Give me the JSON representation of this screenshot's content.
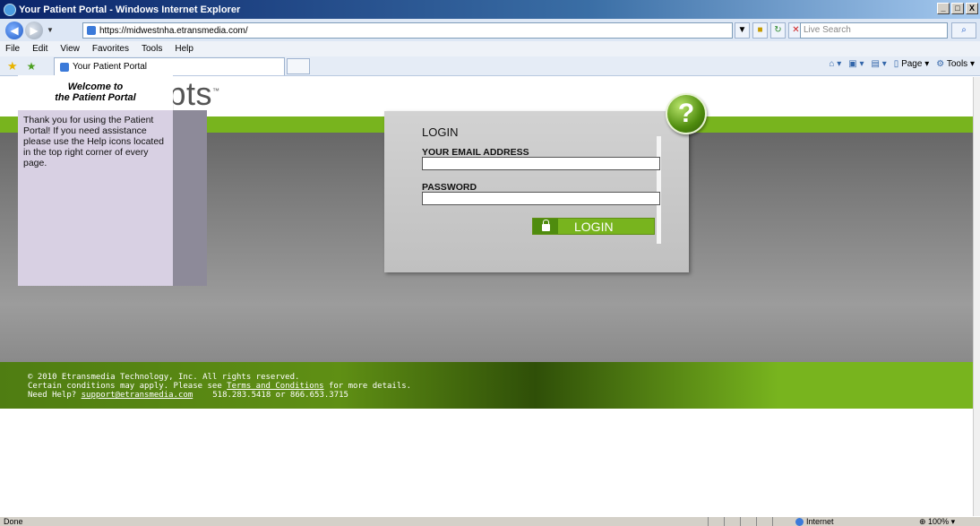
{
  "window": {
    "title": "Your Patient Portal - Windows Internet Explorer",
    "buttons": [
      "_",
      "□",
      "X"
    ]
  },
  "address": {
    "url": "https://midwestnha.etransmedia.com/",
    "search_placeholder": "Live Search"
  },
  "menu": [
    "File",
    "Edit",
    "View",
    "Favorites",
    "Tools",
    "Help"
  ],
  "tab": {
    "title": "Your Patient Portal"
  },
  "command_bar": {
    "page": "Page",
    "tools": "Tools"
  },
  "brand": {
    "name": "Allscripts",
    "tm": "™"
  },
  "welcome": {
    "title_line1": "Welcome to",
    "title_line2": "the Patient Portal",
    "body": "Thank you for using the Patient Portal! If you need assistance please use the Help icons located in the top right corner of every page."
  },
  "login": {
    "heading": "LOGIN",
    "email_label": "YOUR EMAIL ADDRESS",
    "password_label": "PASSWORD",
    "button_label": "LOGIN",
    "help_symbol": "?"
  },
  "footer": {
    "copyright": "© 2010 Etransmedia Technology, Inc. All rights reserved.",
    "conditions_prefix": "Certain conditions may apply. Please see ",
    "conditions_link": "Terms and Conditions",
    "conditions_suffix": " for more details.",
    "help_prefix": "Need Help? ",
    "help_email": "support@etransmedia.com",
    "phones": "518.283.5418 or 866.653.3715"
  },
  "status": {
    "text": "Done",
    "zone": "Internet",
    "zoom": "100%"
  },
  "colors": {
    "brand_green": "#78b41e",
    "welcome_panel": "#d8d0e3",
    "title_bar": "#0a246a"
  }
}
